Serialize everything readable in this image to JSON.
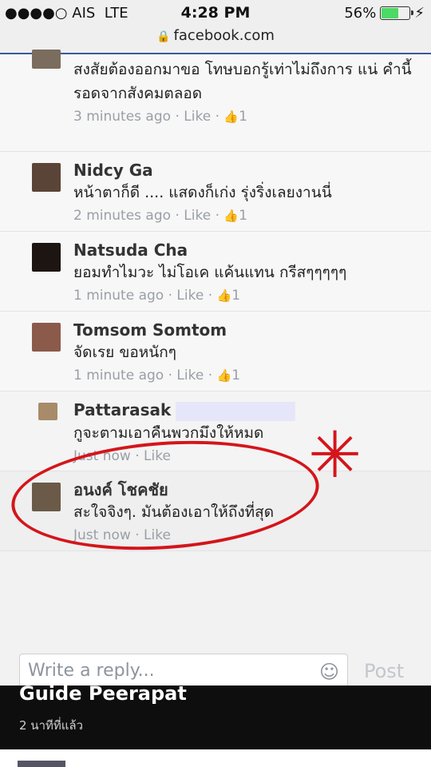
{
  "status": {
    "carrier": "●●●●○ AIS",
    "network": "LTE",
    "time": "4:28 PM",
    "battery_text": "56%",
    "battery_level": 0.56
  },
  "browser": {
    "url": "facebook.com"
  },
  "comments": [
    {
      "name": "",
      "text": "สงสัยต้องออกมาขอ โทษบอกรู้เท่าไม่ถึงการ แน่ คำนี้รอดจากสังคมตลอด",
      "time": "3 minutes ago",
      "like": "Like",
      "count": "1"
    },
    {
      "name": "Nidcy Ga",
      "text": "หน้าตาก็ดี .... แสดงก็เก่ง     รุ่งริ่งเลยงานนี่",
      "time": "2 minutes ago",
      "like": "Like",
      "count": "1"
    },
    {
      "name": "Natsuda Cha",
      "text": "ยอมทำไมวะ ไม่โอเค แค้นแทน กรีสๆๆๆๆๆ",
      "time": "1 minute ago",
      "like": "Like",
      "count": "1"
    },
    {
      "name": "Tomsom Somtom",
      "text": "จัดเรย ขอหนักๆ",
      "time": "1 minute ago",
      "like": "Like",
      "count": "1"
    },
    {
      "name": "Pattarasak",
      "text": "กูจะตามเอาคืนพวกมึงให้หมด",
      "time": "Just now",
      "like": "Like",
      "count": ""
    },
    {
      "name": "อนงค์ โชคชัย",
      "text": "สะใจจิงๆ. มันต้องเอาให้ถึงที่สุด",
      "time": "Just now",
      "like": "Like",
      "count": ""
    }
  ],
  "reply": {
    "placeholder": "Write a reply...",
    "post_label": "Post"
  },
  "overlay": {
    "author": "Guide Peerapat",
    "time": "2 นาทีที่แล้ว"
  }
}
